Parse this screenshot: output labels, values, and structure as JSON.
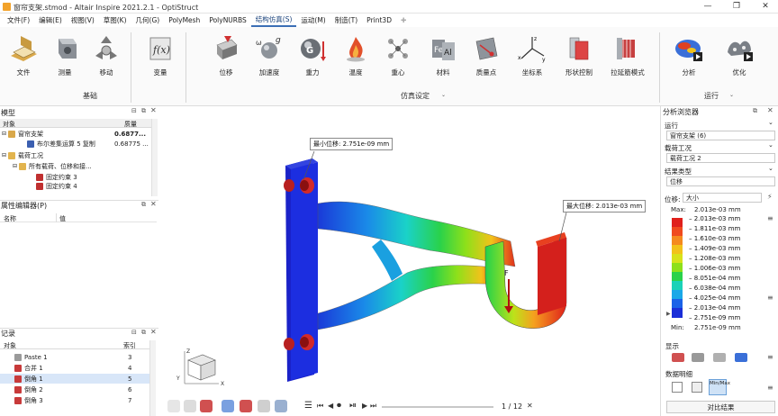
{
  "window": {
    "title": "窗帘支架.stmod - Altair Inspire 2021.2.1 - OptiStruct"
  },
  "menu": [
    "文件(F)",
    "编辑(E)",
    "视图(V)",
    "草图(K)",
    "几何(G)",
    "PolyMesh",
    "PolyNURBS",
    "结构仿真(S)",
    "运动(M)",
    "制造(T)",
    "Print3D"
  ],
  "ribbon": {
    "basic": {
      "group_label": "基础",
      "buttons": [
        "文件",
        "测量",
        "移动",
        "变量"
      ]
    },
    "sim": {
      "group_label": "仿真设定",
      "buttons": [
        "位移",
        "加速度",
        "重力",
        "温度",
        "重心",
        "材料",
        "质量点",
        "坐标系",
        "形状控制",
        "拉延筋模式"
      ]
    },
    "run": {
      "group_label": "运行",
      "buttons": [
        "分析",
        "优化"
      ]
    }
  },
  "model_panel": {
    "title": "模型",
    "columns": [
      "对象",
      "质量"
    ],
    "rows": [
      {
        "name": "窗帘支架",
        "value": "0.6877...",
        "bold": true
      },
      {
        "name": "布尔差集运算 5 复制",
        "value": "0.68775 ..."
      },
      {
        "name": "载荷工况",
        "value": ""
      },
      {
        "name": "所有载荷、位移和接...",
        "value": ""
      },
      {
        "name": "固定约束 3",
        "value": ""
      },
      {
        "name": "固定约束 4",
        "value": ""
      }
    ]
  },
  "props_panel": {
    "title": "属性编辑器(P)",
    "columns": [
      "名称",
      "值"
    ]
  },
  "log_panel": {
    "title": "记录",
    "columns": [
      "对象",
      "索引"
    ],
    "rows": [
      {
        "name": "Paste 1",
        "index": "3"
      },
      {
        "name": "合并 1",
        "index": "4"
      },
      {
        "name": "倒角 1",
        "index": "5"
      },
      {
        "name": "倒角 2",
        "index": "6"
      },
      {
        "name": "倒角 3",
        "index": "7"
      }
    ]
  },
  "viewport": {
    "min_label": "最小位移: 2.751e-09 mm",
    "max_label": "最大位移: 2.013e-03 mm",
    "force_label": "F",
    "axes": {
      "x": "X",
      "y": "Y",
      "z": "Z"
    },
    "frame_counter": "1 / 12"
  },
  "analysis": {
    "title": "分析浏览器",
    "run_label": "运行",
    "run_value": "窗帘支架 (6)",
    "loadcase_label": "载荷工况",
    "loadcase_value": "载荷工况 2",
    "result_label": "结果类型",
    "result_value": "位移",
    "disp_label": "位移:",
    "disp_value": "大小",
    "max_text": "Max:",
    "max_value": "2.013e-03 mm",
    "min_text": "Min:",
    "min_value": "2.751e-09 mm",
    "legend_values": [
      "2.013e-03 mm",
      "1.811e-03 mm",
      "1.610e-03 mm",
      "1.409e-03 mm",
      "1.208e-03 mm",
      "1.006e-03 mm",
      "8.051e-04 mm",
      "6.038e-04 mm",
      "4.025e-04 mm",
      "2.013e-04 mm",
      "2.751e-09 mm"
    ],
    "legend_colors": [
      "#e0201c",
      "#f04a1e",
      "#f58a1e",
      "#f2c21a",
      "#d8e21a",
      "#8ee01a",
      "#2ad24a",
      "#1ad2b8",
      "#1aa8e8",
      "#1a62e8",
      "#1a2ed8"
    ],
    "display_label": "显示",
    "detail_label": "数据明细",
    "minmax_label": "Min/Max",
    "compare_button": "对比结果"
  }
}
